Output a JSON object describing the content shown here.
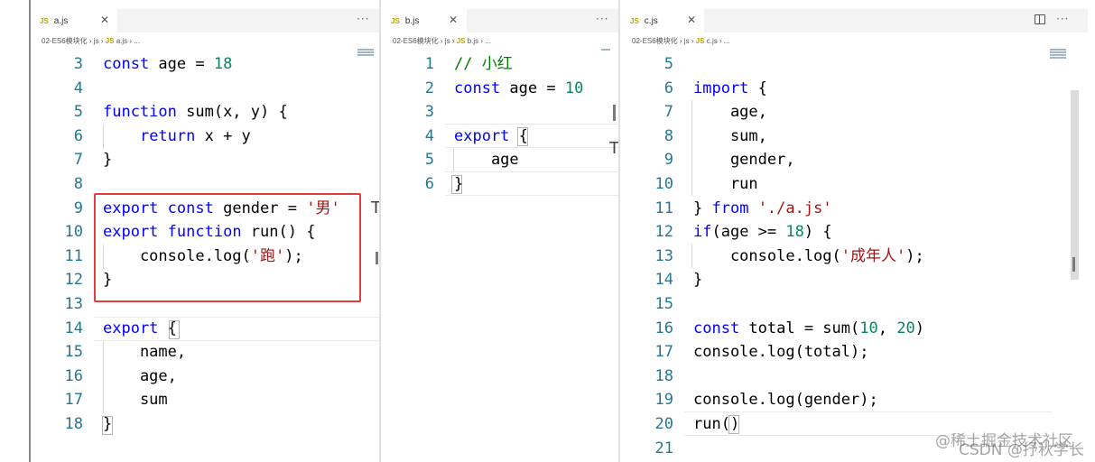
{
  "panes": [
    {
      "tab": {
        "icon": "JS",
        "label": "a.js"
      },
      "breadcrumb": {
        "folder": "02-ES6模块化",
        "dir": "js",
        "file_icon": "JS",
        "file": "a.js",
        "tail": "..."
      },
      "lines": [
        {
          "no": "3",
          "tokens": [
            {
              "t": "const",
              "c": "kw"
            },
            {
              "t": " age = "
            },
            {
              "t": "18",
              "c": "num"
            }
          ]
        },
        {
          "no": "4",
          "tokens": []
        },
        {
          "no": "5",
          "tokens": [
            {
              "t": "function",
              "c": "kw"
            },
            {
              "t": " sum(x, y) {"
            }
          ]
        },
        {
          "no": "6",
          "tokens": [
            {
              "t": "    "
            },
            {
              "t": "return",
              "c": "kw"
            },
            {
              "t": " x + y"
            }
          ]
        },
        {
          "no": "7",
          "tokens": [
            {
              "t": "}"
            }
          ]
        },
        {
          "no": "8",
          "tokens": []
        },
        {
          "no": "9",
          "tokens": [
            {
              "t": "export",
              "c": "kw"
            },
            {
              "t": " "
            },
            {
              "t": "const",
              "c": "kw"
            },
            {
              "t": " gender = "
            },
            {
              "t": "'男'",
              "c": "str"
            }
          ]
        },
        {
          "no": "10",
          "tokens": [
            {
              "t": "export",
              "c": "kw"
            },
            {
              "t": " "
            },
            {
              "t": "function",
              "c": "kw"
            },
            {
              "t": " run() {"
            }
          ]
        },
        {
          "no": "11",
          "tokens": [
            {
              "t": "    console.log("
            },
            {
              "t": "'跑'",
              "c": "str"
            },
            {
              "t": ");"
            }
          ]
        },
        {
          "no": "12",
          "tokens": [
            {
              "t": "}"
            }
          ]
        },
        {
          "no": "13",
          "tokens": []
        },
        {
          "no": "14",
          "tokens": [
            {
              "t": "export",
              "c": "kw"
            },
            {
              "t": " {"
            }
          ]
        },
        {
          "no": "15",
          "tokens": [
            {
              "t": "    name,"
            }
          ]
        },
        {
          "no": "16",
          "tokens": [
            {
              "t": "    age,"
            }
          ]
        },
        {
          "no": "17",
          "tokens": [
            {
              "t": "    sum"
            }
          ]
        },
        {
          "no": "18",
          "tokens": [
            {
              "t": "}"
            }
          ]
        }
      ]
    },
    {
      "tab": {
        "icon": "JS",
        "label": "b.js"
      },
      "breadcrumb": {
        "folder": "02-ES6模块化",
        "dir": "js",
        "file_icon": "JS",
        "file": "b.js",
        "tail": "..."
      },
      "lines": [
        {
          "no": "1",
          "tokens": [
            {
              "t": "// 小红",
              "c": "cm"
            }
          ]
        },
        {
          "no": "2",
          "tokens": [
            {
              "t": "const",
              "c": "kw"
            },
            {
              "t": " age = "
            },
            {
              "t": "10",
              "c": "num"
            }
          ]
        },
        {
          "no": "3",
          "tokens": []
        },
        {
          "no": "4",
          "tokens": [
            {
              "t": "export",
              "c": "kw"
            },
            {
              "t": " {"
            }
          ]
        },
        {
          "no": "5",
          "tokens": [
            {
              "t": "    age"
            }
          ]
        },
        {
          "no": "6",
          "tokens": [
            {
              "t": "}"
            }
          ]
        }
      ]
    },
    {
      "tab": {
        "icon": "JS",
        "label": "c.js"
      },
      "breadcrumb": {
        "folder": "02-ES6模块化",
        "dir": "js",
        "file_icon": "JS",
        "file": "c.js",
        "tail": "..."
      },
      "lines": [
        {
          "no": "5",
          "tokens": []
        },
        {
          "no": "6",
          "tokens": [
            {
              "t": "import",
              "c": "kw"
            },
            {
              "t": " {"
            }
          ]
        },
        {
          "no": "7",
          "tokens": [
            {
              "t": "    age,"
            }
          ]
        },
        {
          "no": "8",
          "tokens": [
            {
              "t": "    sum,"
            }
          ]
        },
        {
          "no": "9",
          "tokens": [
            {
              "t": "    gender,"
            }
          ]
        },
        {
          "no": "10",
          "tokens": [
            {
              "t": "    run"
            }
          ]
        },
        {
          "no": "11",
          "tokens": [
            {
              "t": "} "
            },
            {
              "t": "from",
              "c": "kw"
            },
            {
              "t": " "
            },
            {
              "t": "'./a.js'",
              "c": "str"
            }
          ]
        },
        {
          "no": "12",
          "tokens": [
            {
              "t": "if",
              "c": "kw"
            },
            {
              "t": "(age >= "
            },
            {
              "t": "18",
              "c": "num"
            },
            {
              "t": ") {"
            }
          ]
        },
        {
          "no": "13",
          "tokens": [
            {
              "t": "    console.log("
            },
            {
              "t": "'成年人'",
              "c": "str"
            },
            {
              "t": ");"
            }
          ]
        },
        {
          "no": "14",
          "tokens": [
            {
              "t": "}"
            }
          ]
        },
        {
          "no": "15",
          "tokens": []
        },
        {
          "no": "16",
          "tokens": [
            {
              "t": "const",
              "c": "kw"
            },
            {
              "t": " total = sum("
            },
            {
              "t": "10",
              "c": "num"
            },
            {
              "t": ", "
            },
            {
              "t": "20",
              "c": "num"
            },
            {
              "t": ")"
            }
          ]
        },
        {
          "no": "17",
          "tokens": [
            {
              "t": "console.log(total);"
            }
          ]
        },
        {
          "no": "18",
          "tokens": []
        },
        {
          "no": "19",
          "tokens": [
            {
              "t": "console.log(gender);"
            }
          ]
        },
        {
          "no": "20",
          "tokens": [
            {
              "t": "run()"
            }
          ]
        },
        {
          "no": "21",
          "tokens": []
        }
      ]
    }
  ],
  "watermark": {
    "line1": "@稀土掘金技术社区",
    "line2": "CSDN @抒秋学长"
  },
  "colors": {
    "keyword": "#0000ff",
    "number": "#098658",
    "string": "#a31515",
    "comment": "#008000",
    "line_number": "#237893",
    "highlight_border": "#e23c3c"
  }
}
